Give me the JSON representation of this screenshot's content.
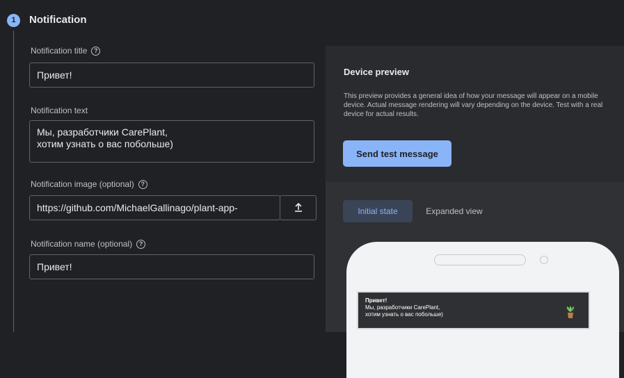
{
  "step": {
    "number": "1",
    "title": "Notification"
  },
  "fields": {
    "title": {
      "label": "Notification title",
      "value": "Привет!"
    },
    "text": {
      "label": "Notification text",
      "line1": "Мы, разработчики CarePlant,",
      "line2": "хотим узнать о вас побольше)"
    },
    "image": {
      "label": "Notification image (optional)",
      "value": "https://github.com/MichaelGallinago/plant-app-"
    },
    "name": {
      "label": "Notification name (optional)",
      "value": "Привет!"
    }
  },
  "preview": {
    "title": "Device preview",
    "description": "This preview provides a general idea of how your message will appear on a mobile device. Actual message rendering will vary depending on the device. Test with a real device for actual results.",
    "send_button": "Send test message",
    "tabs": [
      "Initial state",
      "Expanded view"
    ],
    "notification": {
      "title": "Привет!",
      "line1": "Мы, разработчики CarePlant,",
      "line2": "хотим узнать о вас побольше)"
    }
  },
  "icons": {
    "help": "help-icon",
    "upload": "upload-icon",
    "plant": "plant-icon"
  },
  "colors": {
    "accent": "#8ab4f8",
    "background": "#202124"
  }
}
